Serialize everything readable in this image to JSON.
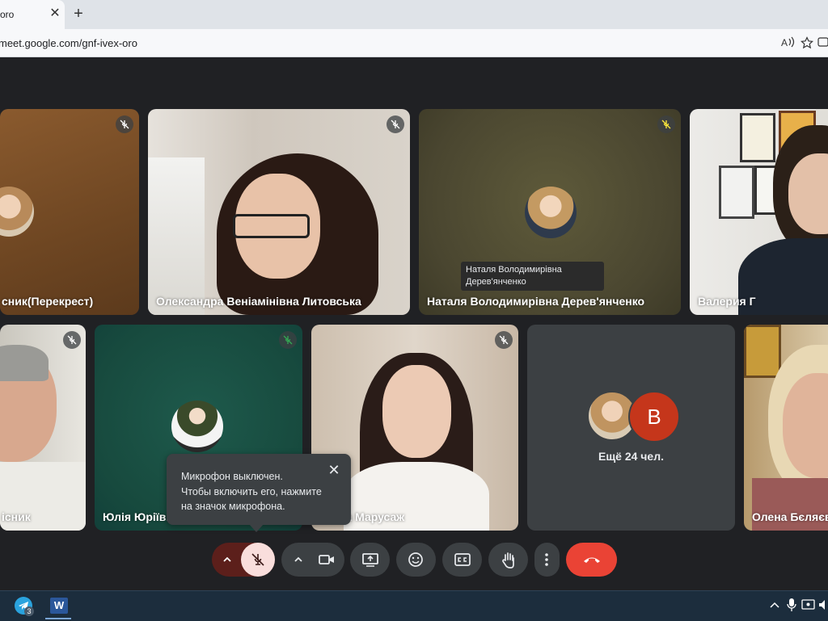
{
  "browser": {
    "tab_title": "oro",
    "tab_close": "✕",
    "new_tab": "+",
    "url": "meet.google.com/gnf-ivex-oro"
  },
  "icons": [
    "close-icon",
    "plus-icon",
    "read-aloud-icon",
    "favorite-star-icon",
    "collections-icon",
    "mic-off-icon",
    "chevron-up-icon",
    "camera-icon",
    "present-screen-icon",
    "emoji-icon",
    "captions-icon",
    "raise-hand-icon",
    "more-vert-icon",
    "end-call-icon",
    "telegram-icon",
    "word-icon",
    "volume-icon"
  ],
  "participants": {
    "row1": [
      {
        "name": "сник(Перекрест)"
      },
      {
        "name": "Олександра Веніамінівна Литовська"
      },
      {
        "name": "Наталя Володимирівна Дерев'янченко"
      },
      {
        "name": "Валерия Г"
      }
    ],
    "row2": [
      {
        "name": "існик"
      },
      {
        "name": "Юлія Юріївна"
      },
      {
        "name": "Ганна Марусаж"
      },
      {
        "name": "Ещё 24 чел."
      },
      {
        "name": "Олена Бєляєва"
      }
    ]
  },
  "hover_tooltip": {
    "line1": "Наталя Володимирівна",
    "line2": "Дерев'янченко"
  },
  "others_avatar_letter": "B",
  "mic_notice": {
    "line1": "Микрофон выключен.",
    "line2": "Чтобы включить его, нажмите",
    "line3": "на значок микрофона.",
    "close": "✕"
  },
  "taskbar": {
    "telegram_badge": "3",
    "word_letter": "W"
  },
  "colors": {
    "accent_red": "#ea4335",
    "mic_off_bg": "#f9dedc",
    "meet_bg": "#202124"
  }
}
